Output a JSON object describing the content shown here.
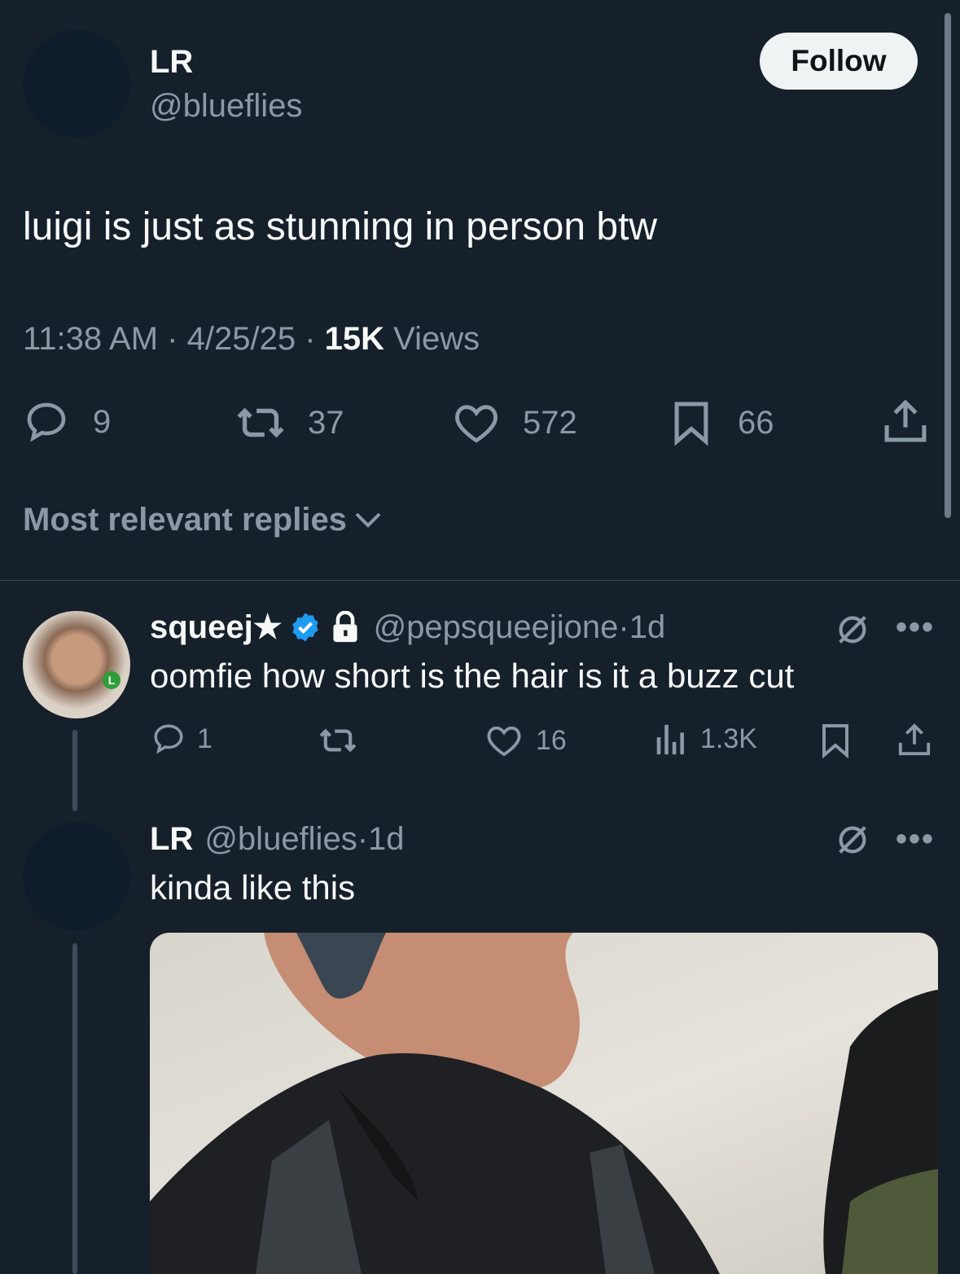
{
  "tweet": {
    "name": "LR",
    "handle": "@blueflies",
    "follow_label": "Follow",
    "text": "luigi is just as stunning in person btw",
    "time": "11:38 AM",
    "date": "4/25/25",
    "views_count": "15K",
    "views_label": "Views",
    "replies": "9",
    "retweets": "37",
    "likes": "572",
    "bookmarks": "66"
  },
  "sort": {
    "label": "Most relevant replies"
  },
  "reply1": {
    "name": "squeej★",
    "handle": "@pepsqueejione",
    "age": "1d",
    "text": "oomfie how short is the hair is it a buzz cut",
    "replies": "1",
    "likes": "16",
    "views": "1.3K",
    "avatar_badge": "L"
  },
  "reply2": {
    "name": "LR",
    "handle": "@blueflies",
    "age": "1d",
    "text": "kinda like this"
  },
  "colors": {
    "background": "#15202b",
    "text": "#f7f9f9",
    "secondary": "#8b98a5",
    "verified": "#1d9bf0"
  }
}
